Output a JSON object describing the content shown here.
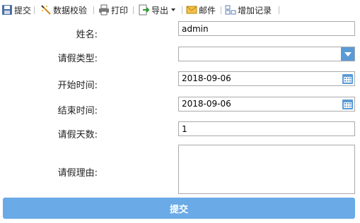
{
  "toolbar": {
    "submit": "提交",
    "validate": "数据校验",
    "print": "打印",
    "export": "导出",
    "mail": "邮件",
    "add_record": "增加记录"
  },
  "form": {
    "name_label": "姓名:",
    "name_value": "admin",
    "leave_type_label": "请假类型:",
    "leave_type_value": "",
    "start_label": "开始时间:",
    "start_value": "2018-09-06",
    "end_label": "结束时间:",
    "end_value": "2018-09-06",
    "days_label": "请假天数:",
    "days_value": "1",
    "reason_label": "请假理由:",
    "reason_value": ""
  },
  "submit_button": "提交",
  "colors": {
    "accent": "#5b9bd5",
    "submit_bg": "#6aaae6"
  }
}
